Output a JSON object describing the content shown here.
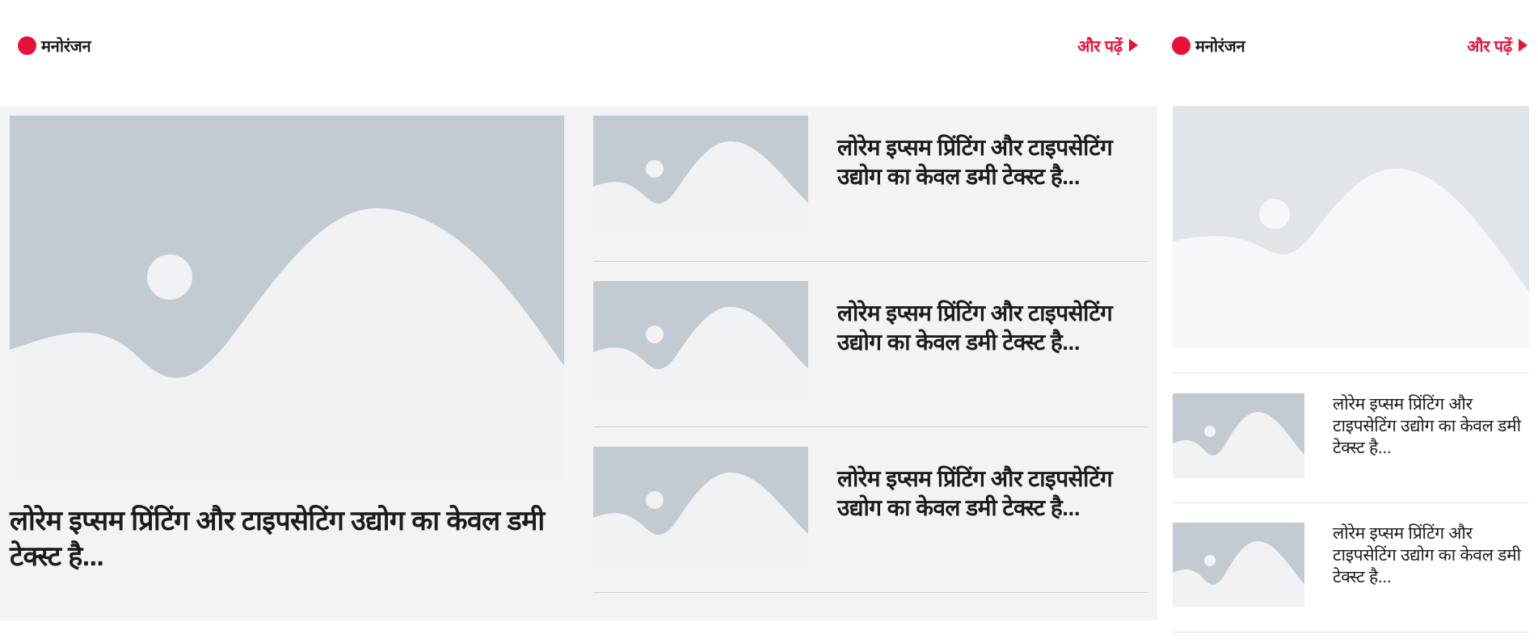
{
  "section_left": {
    "title": "मनोरंजन",
    "more_label": "और पढ़ें",
    "featured": {
      "title": "लोरेम इप्सम प्रिंटिंग और टाइपसेटिंग उद्योग का केवल डमी टेक्स्ट है..."
    },
    "list": [
      {
        "title": "लोरेम इप्सम प्रिंटिंग और टाइपसेटिंग उद्योग का केवल डमी टेक्स्ट है..."
      },
      {
        "title": "लोरेम इप्सम प्रिंटिंग और टाइपसेटिंग उद्योग का केवल डमी टेक्स्ट है..."
      },
      {
        "title": "लोरेम इप्सम प्रिंटिंग और टाइपसेटिंग उद्योग का केवल डमी टेक्स्ट है..."
      }
    ]
  },
  "section_right": {
    "title": "मनोरंजन",
    "more_label": "और पढ़ें",
    "list": [
      {
        "title": "लोरेम इप्सम प्रिंटिंग और टाइपसेटिंग उद्योग का केवल डमी टेक्स्ट है..."
      },
      {
        "title": "लोरेम इप्सम प्रिंटिंग और टाइपसेटिंग उद्योग का केवल डमी टेक्स्ट है..."
      }
    ]
  },
  "colors": {
    "accent": "#e8113a",
    "placeholder_bg": "#c2cad2",
    "placeholder_fg": "#f1f2f3",
    "band": "#f3f3f3"
  },
  "icons": {
    "section_marker": "red-dot-icon",
    "more_arrow": "triangle-right-icon",
    "image": "image-placeholder-icon"
  }
}
